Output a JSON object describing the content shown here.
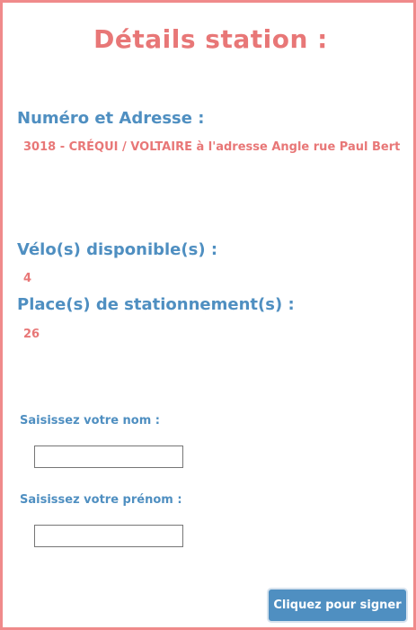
{
  "page": {
    "title": "Détails station :"
  },
  "station": {
    "address_heading": "Numéro et Adresse :",
    "address_value": "3018 - CRÉQUI / VOLTAIRE à l'adresse Angle rue Paul Bert",
    "bikes_heading": "Vélo(s) disponible(s) :",
    "bikes_value": "4",
    "parking_heading": "Place(s) de stationnement(s) :",
    "parking_value": "26"
  },
  "form": {
    "last_name_label": "Saisissez votre nom :",
    "last_name_value": "",
    "first_name_label": "Saisissez votre prénom :",
    "first_name_value": "",
    "submit_label": "Cliquez pour signer"
  },
  "colors": {
    "accent_pink": "#e87777",
    "border_pink": "#f08a8b",
    "accent_blue": "#4f8fc1"
  }
}
